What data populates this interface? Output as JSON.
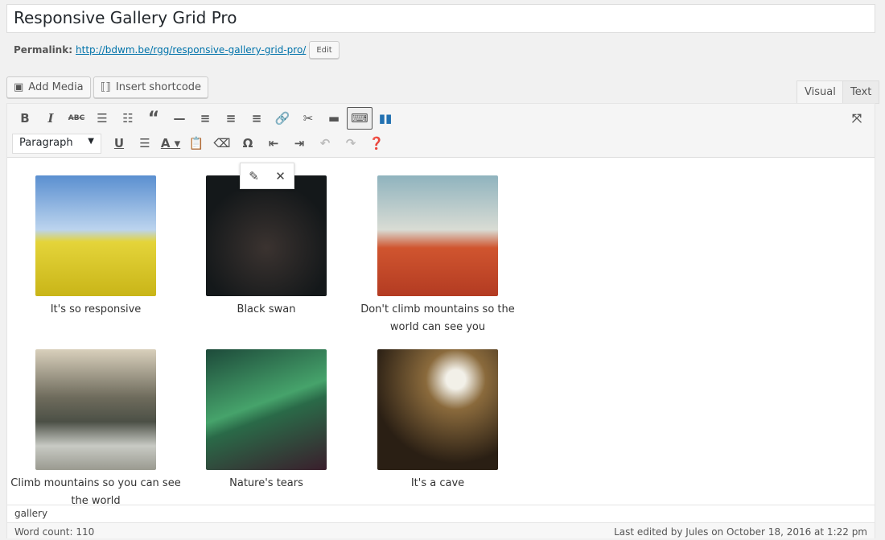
{
  "title": "Responsive Gallery Grid Pro",
  "permalink": {
    "label": "Permalink:",
    "url": "http://bdwm.be/rgg/responsive-gallery-grid-pro/",
    "edit": "Edit"
  },
  "media": {
    "add_media": "Add Media",
    "insert_shortcode": "Insert shortcode"
  },
  "tabs": {
    "visual": "Visual",
    "text": "Text"
  },
  "toolbar": {
    "format_select": "Paragraph"
  },
  "gallery": [
    {
      "caption": "It's so responsive"
    },
    {
      "caption": "Black swan"
    },
    {
      "caption": "Don't climb mountains so the world can see you"
    },
    {
      "caption": "Climb mountains so you can see the world"
    },
    {
      "caption": "Nature's tears"
    },
    {
      "caption": "It's a cave"
    }
  ],
  "path": "gallery",
  "status": {
    "word_count": "Word count: 110",
    "last_edited": "Last edited by Jules on October 18, 2016 at 1:22 pm"
  }
}
